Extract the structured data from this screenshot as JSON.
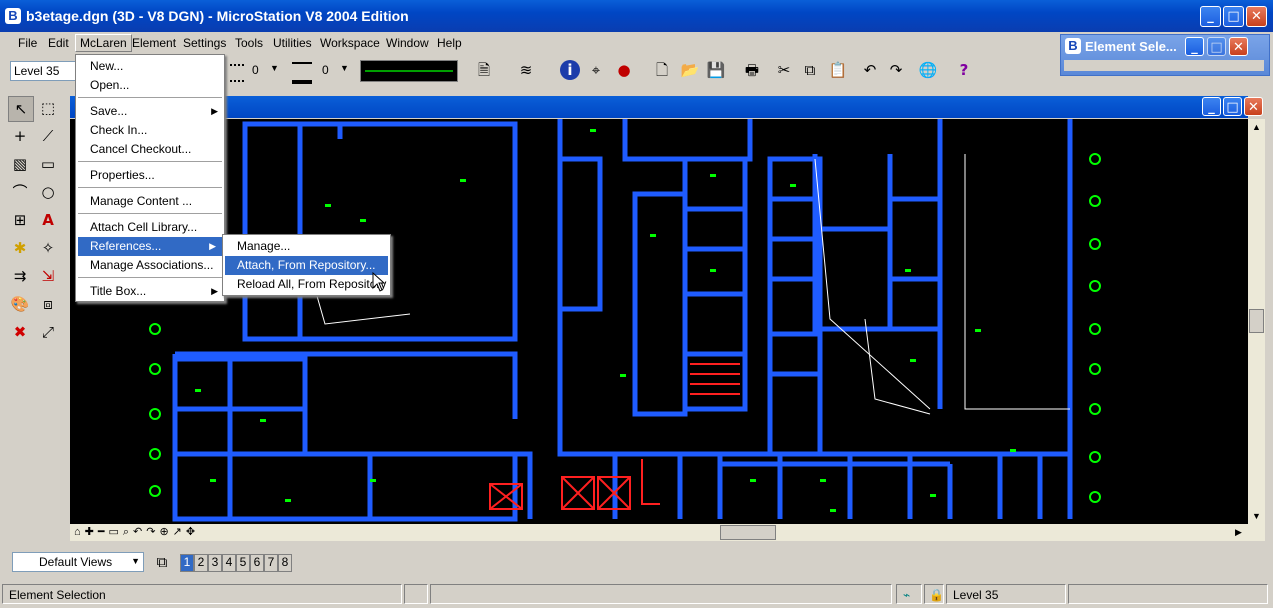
{
  "app": {
    "title": "b3etage.dgn (3D - V8 DGN) - MicroStation V8 2004 Edition",
    "icon": "microstation-logo-icon"
  },
  "element_selection_window": {
    "title": "Element Sele..."
  },
  "menubar": {
    "items": [
      "File",
      "Edit",
      "McLaren",
      "Element",
      "Settings",
      "Tools",
      "Utilities",
      "Workspace",
      "Window",
      "Help"
    ]
  },
  "toolbar": {
    "level_value": "Level 35",
    "weight_a": "0",
    "weight_b": "0"
  },
  "mclaren_menu": {
    "items": [
      "New...",
      "Open...",
      "Save...",
      "Check In...",
      "Cancel Checkout...",
      "Properties...",
      "Manage Content ...",
      "Attach Cell Library...",
      "References...",
      "Manage Associations...",
      "Title Box..."
    ]
  },
  "references_submenu": {
    "items": [
      "Manage...",
      "Attach, From Repository...",
      "Reload All, From Repository"
    ]
  },
  "view_controls": {
    "views_dropdown": "Default Views",
    "view_numbers": [
      "1",
      "2",
      "3",
      "4",
      "5",
      "6",
      "7",
      "8"
    ]
  },
  "statusbar": {
    "message": "Element Selection",
    "level": "Level 35"
  },
  "colors": {
    "floorplan_walls": "#1f5cff",
    "floorplan_markers": "#00ff00",
    "highlight": "#316ac5"
  }
}
